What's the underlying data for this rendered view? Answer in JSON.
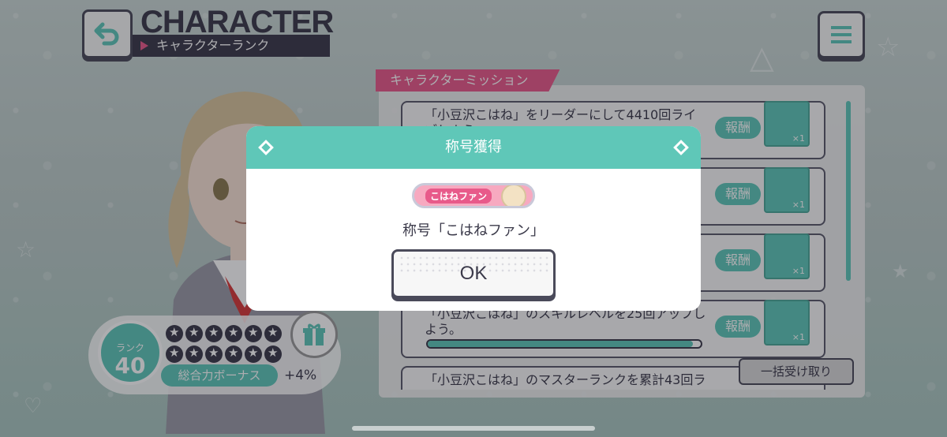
{
  "header": {
    "title_en": "CHARACTER",
    "title_jp": "キャラクターランク"
  },
  "icons": {
    "back": "back-arrow-icon",
    "menu": "hamburger-menu-icon",
    "gift": "gift-icon"
  },
  "mission": {
    "tab_label": "キャラクターミッション",
    "rows": [
      {
        "text": "「小豆沢こはね」をリーダーにして4410回ライブしよう。",
        "reward_label": "報酬",
        "reward_count": "×1"
      },
      {
        "text": "",
        "reward_label": "報酬",
        "reward_count": "×1"
      },
      {
        "text": "",
        "reward_label": "報酬",
        "reward_count": "×1"
      },
      {
        "text": "「小豆沢こはね」のスキルレベルを25回アップしよう。",
        "reward_label": "報酬",
        "reward_count": "×1",
        "progress": 0.97
      },
      {
        "text": "「小豆沢こはね」のマスターランクを累計43回ラ"
      }
    ],
    "collect_all": "一括受け取り"
  },
  "rank": {
    "label": "ランク",
    "value": "40",
    "stars": 12,
    "bonus_label": "総合力ボーナス",
    "bonus_value": "+4%"
  },
  "dialog": {
    "title": "称号獲得",
    "badge_text": "こはねファン",
    "message": "称号「こはねファン」",
    "ok": "OK"
  },
  "colors": {
    "accent": "#5fc7b8",
    "pink": "#e85a8a",
    "dark": "#3b3a4a"
  }
}
